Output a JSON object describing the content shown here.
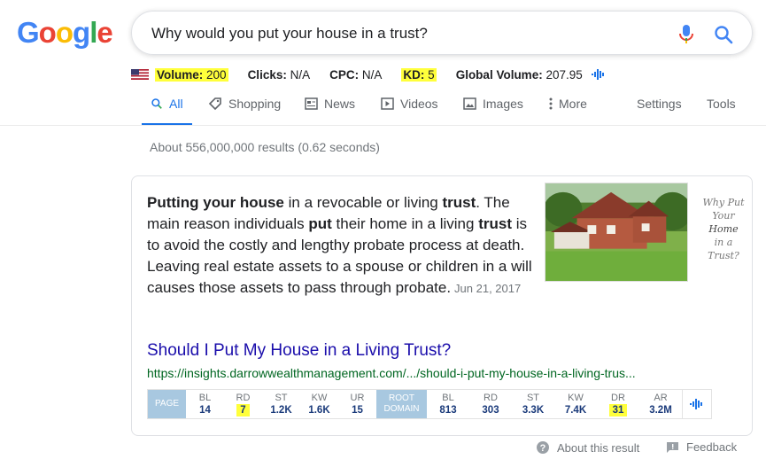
{
  "logo": {
    "letters": [
      "G",
      "o",
      "o",
      "g",
      "l",
      "e"
    ]
  },
  "search": {
    "query": "Why would you put your house in a trust?"
  },
  "metrics": {
    "volume_label": "Volume:",
    "volume_value": "200",
    "clicks_label": "Clicks:",
    "clicks_value": "N/A",
    "cpc_label": "CPC:",
    "cpc_value": "N/A",
    "kd_label": "KD:",
    "kd_value": "5",
    "global_label": "Global Volume:",
    "global_value": "207.95"
  },
  "tabs": [
    {
      "label": "All",
      "icon": "search-icon",
      "active": true
    },
    {
      "label": "Shopping",
      "icon": "tag-icon"
    },
    {
      "label": "News",
      "icon": "newspaper-icon"
    },
    {
      "label": "Videos",
      "icon": "play-icon"
    },
    {
      "label": "Images",
      "icon": "image-icon"
    },
    {
      "label": "More",
      "icon": "more-vert-icon"
    },
    {
      "label": "Settings"
    },
    {
      "label": "Tools"
    }
  ],
  "stats": "About 556,000,000 results (0.62 seconds)",
  "snippet": {
    "parts": [
      {
        "text": "Putting your house",
        "bold": true
      },
      {
        "text": " in a revocable or living ",
        "bold": false
      },
      {
        "text": "trust",
        "bold": true
      },
      {
        "text": ". The main reason individuals ",
        "bold": false
      },
      {
        "text": "put",
        "bold": true
      },
      {
        "text": " their home in a living ",
        "bold": false
      },
      {
        "text": "trust",
        "bold": true
      },
      {
        "text": " is to avoid the costly and lengthy probate process at death. Leaving real estate assets to a spouse or children in a will causes those assets to pass through probate.",
        "bold": false
      }
    ],
    "date": "Jun 21, 2017"
  },
  "image_caption": {
    "line1": "Why Put",
    "line2": "Your",
    "line3": "Home",
    "line4": "in a",
    "line5": "Trust?"
  },
  "result": {
    "title": "Should I Put My House in a Living Trust?",
    "url": "https://insights.darrowwealthmanagement.com/.../should-i-put-my-house-in-a-living-trus..."
  },
  "seo": {
    "page_label": "PAGE",
    "page_metrics": [
      {
        "k": "BL",
        "v": "14"
      },
      {
        "k": "RD",
        "v": "7",
        "hl": true
      },
      {
        "k": "ST",
        "v": "1.2K"
      },
      {
        "k": "KW",
        "v": "1.6K"
      },
      {
        "k": "UR",
        "v": "15"
      }
    ],
    "root_label_1": "ROOT",
    "root_label_2": "DOMAIN",
    "root_metrics": [
      {
        "k": "BL",
        "v": "813"
      },
      {
        "k": "RD",
        "v": "303"
      },
      {
        "k": "ST",
        "v": "3.3K"
      },
      {
        "k": "KW",
        "v": "7.4K"
      },
      {
        "k": "DR",
        "v": "31",
        "hl": true
      },
      {
        "k": "AR",
        "v": "3.2M"
      }
    ]
  },
  "footer": {
    "about": "About this result",
    "feedback": "Feedback"
  },
  "colors": {
    "link": "#1a0dab",
    "url": "#006621",
    "accent": "#1a73e8",
    "highlight": "#ffff3b",
    "seo_label": "#a8c8e0"
  }
}
